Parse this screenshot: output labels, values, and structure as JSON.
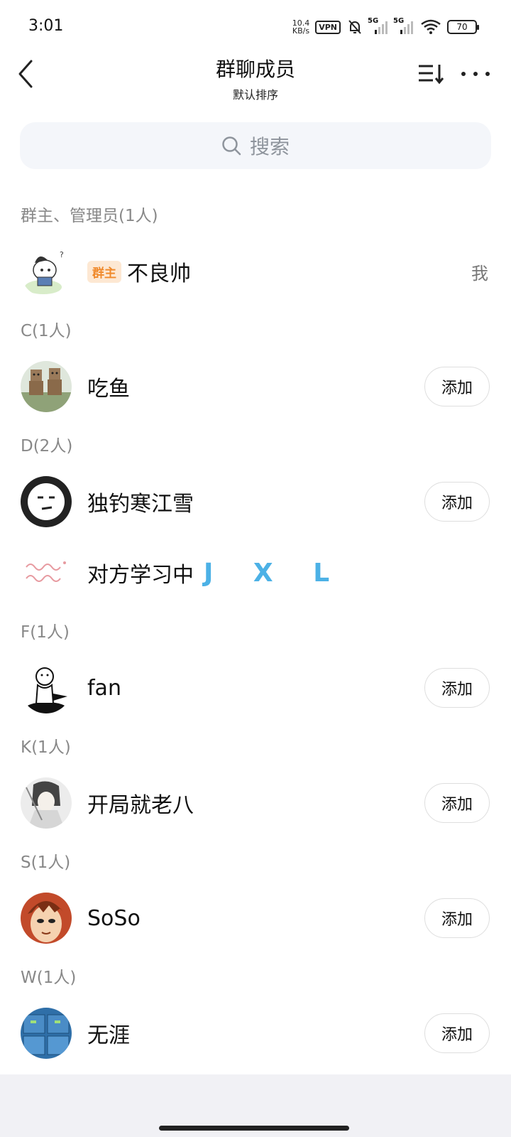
{
  "status_bar": {
    "time": "3:01",
    "net_speed_value": "10.4",
    "net_speed_unit": "KB/s",
    "vpn": "VPN",
    "sim1": "5G",
    "sim2": "5G",
    "wifi_level": "6",
    "battery": "70"
  },
  "header": {
    "title": "群聊成员",
    "subtitle": "默认排序"
  },
  "search": {
    "placeholder": "搜索"
  },
  "sections": [
    {
      "header": "群主、管理员(1人)",
      "members": [
        {
          "name": "不良帅",
          "badge": "群主",
          "right_label": "我"
        }
      ]
    },
    {
      "header": "C(1人)",
      "members": [
        {
          "name": "吃鱼",
          "action": "添加"
        }
      ]
    },
    {
      "header": "D(2人)",
      "members": [
        {
          "name": "独钓寒江雪",
          "action": "添加"
        },
        {
          "name": "对方学习中",
          "suffix": "J X L"
        }
      ]
    },
    {
      "header": "F(1人)",
      "members": [
        {
          "name": "fan",
          "action": "添加"
        }
      ]
    },
    {
      "header": "K(1人)",
      "members": [
        {
          "name": "开局就老八",
          "action": "添加"
        }
      ]
    },
    {
      "header": "S(1人)",
      "members": [
        {
          "name": "SoSo",
          "action": "添加"
        }
      ]
    },
    {
      "header": "W(1人)",
      "members": [
        {
          "name": "无涯",
          "action": "添加"
        }
      ]
    }
  ],
  "colors": {
    "accent_blue": "#4cb1e6",
    "owner_badge_bg": "#fde8d3",
    "owner_badge_text": "#f08a2c",
    "search_bg": "#f4f6fa"
  }
}
